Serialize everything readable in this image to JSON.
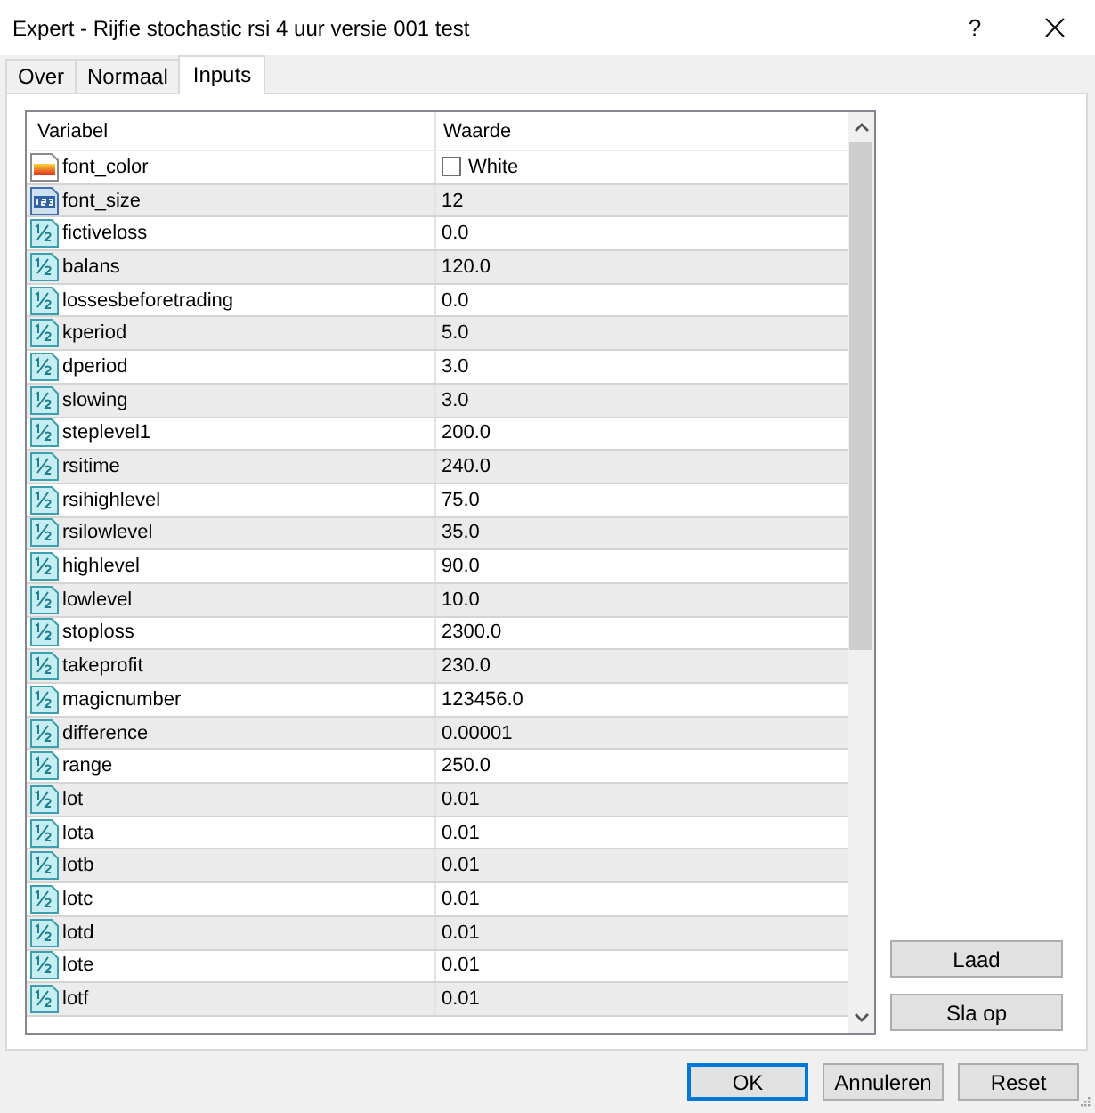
{
  "window": {
    "title": "Expert - Rijfie stochastic rsi 4 uur versie 001 test",
    "help_button": "?"
  },
  "tabs": [
    {
      "label": "Over",
      "selected": false
    },
    {
      "label": "Normaal",
      "selected": false
    },
    {
      "label": "Inputs",
      "selected": true
    }
  ],
  "inputs_table": {
    "columns": [
      "Variabel",
      "Waarde"
    ],
    "rows": [
      {
        "kind": "color",
        "name": "font_color",
        "value": "White",
        "color": "#ffffff"
      },
      {
        "kind": "int",
        "name": "font_size",
        "value": "12"
      },
      {
        "kind": "double",
        "name": "fictiveloss",
        "value": "0.0"
      },
      {
        "kind": "double",
        "name": "balans",
        "value": "120.0"
      },
      {
        "kind": "double",
        "name": "lossesbeforetrading",
        "value": "0.0"
      },
      {
        "kind": "double",
        "name": "kperiod",
        "value": "5.0"
      },
      {
        "kind": "double",
        "name": "dperiod",
        "value": "3.0"
      },
      {
        "kind": "double",
        "name": "slowing",
        "value": "3.0"
      },
      {
        "kind": "double",
        "name": "steplevel1",
        "value": "200.0"
      },
      {
        "kind": "double",
        "name": "rsitime",
        "value": "240.0"
      },
      {
        "kind": "double",
        "name": "rsihighlevel",
        "value": "75.0"
      },
      {
        "kind": "double",
        "name": "rsilowlevel",
        "value": "35.0"
      },
      {
        "kind": "double",
        "name": "highlevel",
        "value": "90.0"
      },
      {
        "kind": "double",
        "name": "lowlevel",
        "value": "10.0"
      },
      {
        "kind": "double",
        "name": "stoploss",
        "value": "2300.0"
      },
      {
        "kind": "double",
        "name": "takeprofit",
        "value": "230.0"
      },
      {
        "kind": "double",
        "name": "magicnumber",
        "value": "123456.0"
      },
      {
        "kind": "double",
        "name": "difference",
        "value": "0.00001"
      },
      {
        "kind": "double",
        "name": "range",
        "value": "250.0"
      },
      {
        "kind": "double",
        "name": "lot",
        "value": "0.01"
      },
      {
        "kind": "double",
        "name": "lota",
        "value": "0.01"
      },
      {
        "kind": "double",
        "name": "lotb",
        "value": "0.01"
      },
      {
        "kind": "double",
        "name": "lotc",
        "value": "0.01"
      },
      {
        "kind": "double",
        "name": "lotd",
        "value": "0.01"
      },
      {
        "kind": "double",
        "name": "lote",
        "value": "0.01"
      },
      {
        "kind": "double",
        "name": "lotf",
        "value": "0.01"
      }
    ]
  },
  "side_buttons": [
    "Laad",
    "Sla op"
  ],
  "buttons": [
    {
      "label": "OK",
      "default": true
    },
    {
      "label": "Annuleren",
      "default": false
    },
    {
      "label": "Reset",
      "default": false
    }
  ]
}
